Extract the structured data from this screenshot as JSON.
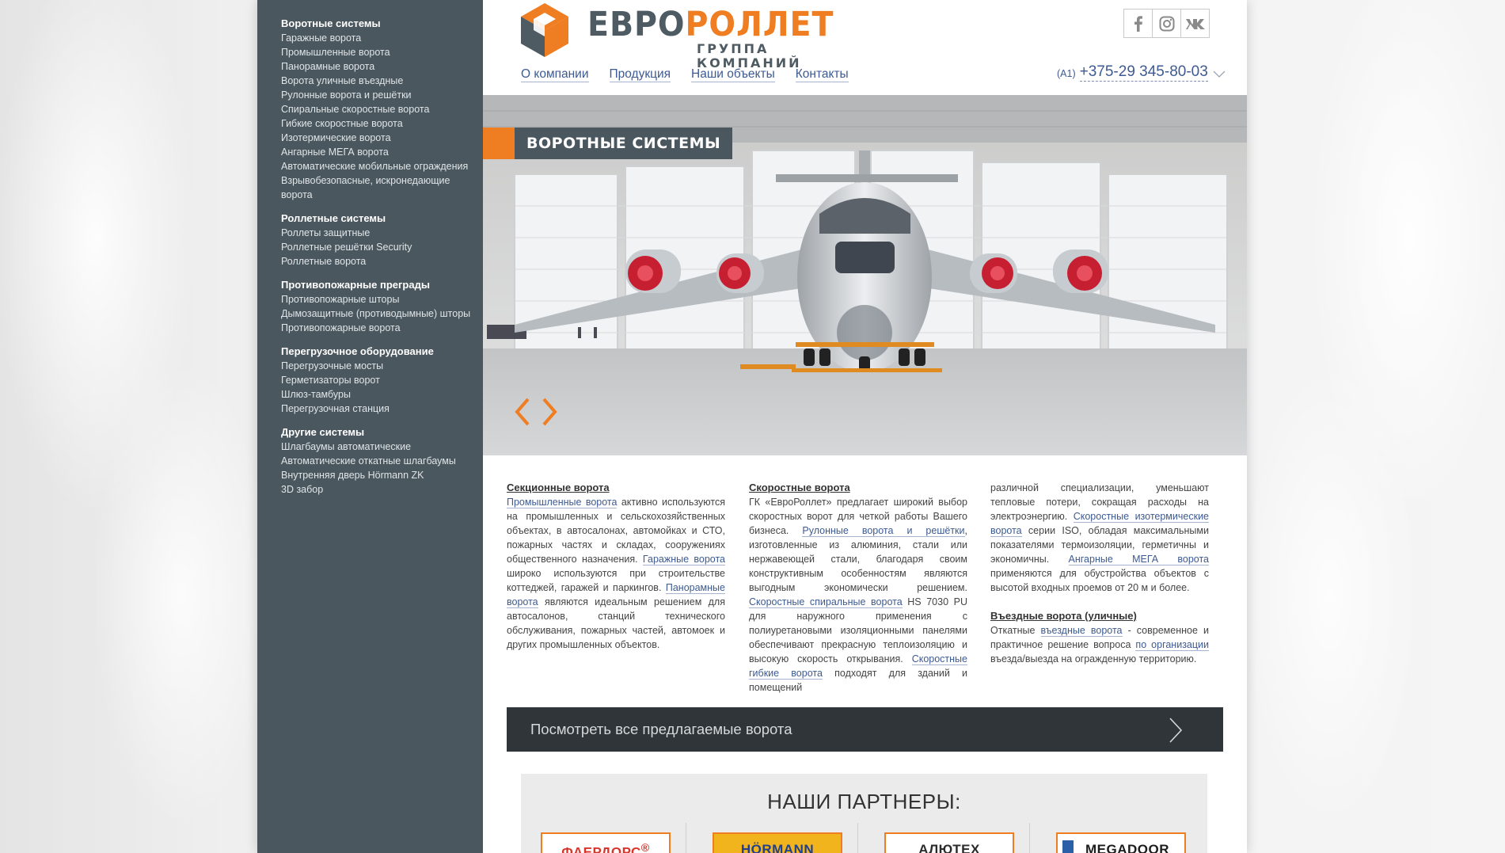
{
  "brand": {
    "name_part1": "ЕВРО",
    "name_part2": "РОЛЛЕТ",
    "tagline": "ГРУППА КОМПАНИЙ",
    "accent_color": "#ef7d22",
    "dark_color": "#4b575e"
  },
  "nav": {
    "items": [
      {
        "label": "О компании"
      },
      {
        "label": "Продукция"
      },
      {
        "label": "Наши объекты"
      },
      {
        "label": "Контакты"
      }
    ]
  },
  "social": {
    "items": [
      {
        "icon": "facebook-icon"
      },
      {
        "icon": "instagram-icon"
      },
      {
        "icon": "vk-icon"
      }
    ]
  },
  "contact": {
    "operator": "(A1)",
    "phone": "+375-29 345-80-03"
  },
  "sidebar": {
    "categories": [
      {
        "title": "Воротные системы",
        "items": [
          "Гаражные ворота",
          "Промышленные ворота",
          "Панорамные ворота",
          "Ворота уличные въездные",
          "Рулонные ворота и решётки",
          "Спиральные скоростные ворота",
          "Гибкие скоростные ворота",
          "Изотермические ворота",
          "Ангарные МЕГА ворота",
          "Автоматические мобильные ограждения",
          "Взрывобезопасные, искронедающие ворота"
        ]
      },
      {
        "title": "Роллетные системы",
        "items": [
          "Роллеты защитные",
          "Роллетные решётки Security",
          "Роллетные ворота"
        ]
      },
      {
        "title": "Противопожарные преграды",
        "items": [
          "Противопожарные шторы",
          "Дымозащитные (противодымные) шторы",
          "Противопожарные ворота"
        ]
      },
      {
        "title": "Перегрузочное оборудование",
        "items": [
          "Перегрузочные мосты",
          "Герметизаторы ворот",
          "Шлюз-тамбуры",
          "Перегрузочная станция"
        ]
      },
      {
        "title": "Другие системы",
        "items": [
          "Шлагбаумы автоматические",
          "Автоматические откатные шлагбаумы",
          "Внутренняя дверь Hörmann ZK",
          "3D забор"
        ]
      }
    ]
  },
  "hero": {
    "label": "ВОРОТНЫЕ СИСТЕМЫ",
    "prev_icon": "chevron-left-icon",
    "next_icon": "chevron-right-icon"
  },
  "content": {
    "col1": {
      "title": "Секционные ворота",
      "s1_link": "Промышленные ворота",
      "s1_text": " активно используются на промышленных и сельскохозяйственных объектах, в автосалонах, автомойках и СТО, пожарных частях и складах, сооружениях общественного назначения. ",
      "s2_link": "Гаражные ворота",
      "s2_text": " широко используются при строительстве коттеджей, гаражей и паркингов. ",
      "s3_link": "Панорамные ворота",
      "s3_text": " являются идеальным решением для автосалонов, станций технического обслуживания, пожарных частей, автомоек и других промышленных объектов."
    },
    "col2": {
      "title": "Скоростные ворота",
      "t1": "ГК «ЕвроРоллет» предлагает широкий выбор скоростных ворот для четкой работы Вашего бизнеса. ",
      "l1": "Рулонные ворота и решётки",
      "t2": ", изготовленные из алюминия, стали или нержавеющей стали, благодаря своим конструктивным особенностям являются выгодным экономически решением. ",
      "l2": "Скоростные спиральные ворота",
      "t3": " HS 7030 PU для наружного применения с полиуретановыми изоляционными панелями обеспечивают прекрасную теплоизоляцию и высокую скорость открывания. ",
      "l3": "Скоростные гибкие ворота",
      "t4": " подходят для зданий и помещений"
    },
    "col3": {
      "t1": "различной специализации, уменьшают тепловые потери, сокращая расходы на электроэнергию. ",
      "l1": "Скоростные изотермические ворота",
      "t2": " серии ISO, обладая максимальными показателями термоизоляции, герметичны и экономичны. ",
      "l2": "Ангарные МЕГА ворота",
      "t3": " применяются для обустройства объектов с высотой входных проемов от 20 м и более.",
      "title2": "Въездные ворота (уличные)",
      "t4": "Откатные ",
      "l3": "въездные ворота",
      "t5": " - современное и практичное решение вопроса ",
      "l4": "по организации",
      "t6": " въезда/выезда на огражденную территорию."
    }
  },
  "cta": {
    "label": "Посмотреть все предлагаемые ворота",
    "icon": "chevron-right-icon"
  },
  "partners": {
    "title": "НАШИ ПАРТНЕРЫ:",
    "logos": [
      {
        "text": "ФАЕРДОРС",
        "mark": "®",
        "color": "#d9362b"
      },
      {
        "text": "HÖRMANN",
        "color": "#1f3f8f"
      },
      {
        "text": "АЛЮТЕХ",
        "color": "#2b2b2b"
      },
      {
        "text": "MEGADOOR",
        "color": "#1c1c1c"
      }
    ]
  }
}
